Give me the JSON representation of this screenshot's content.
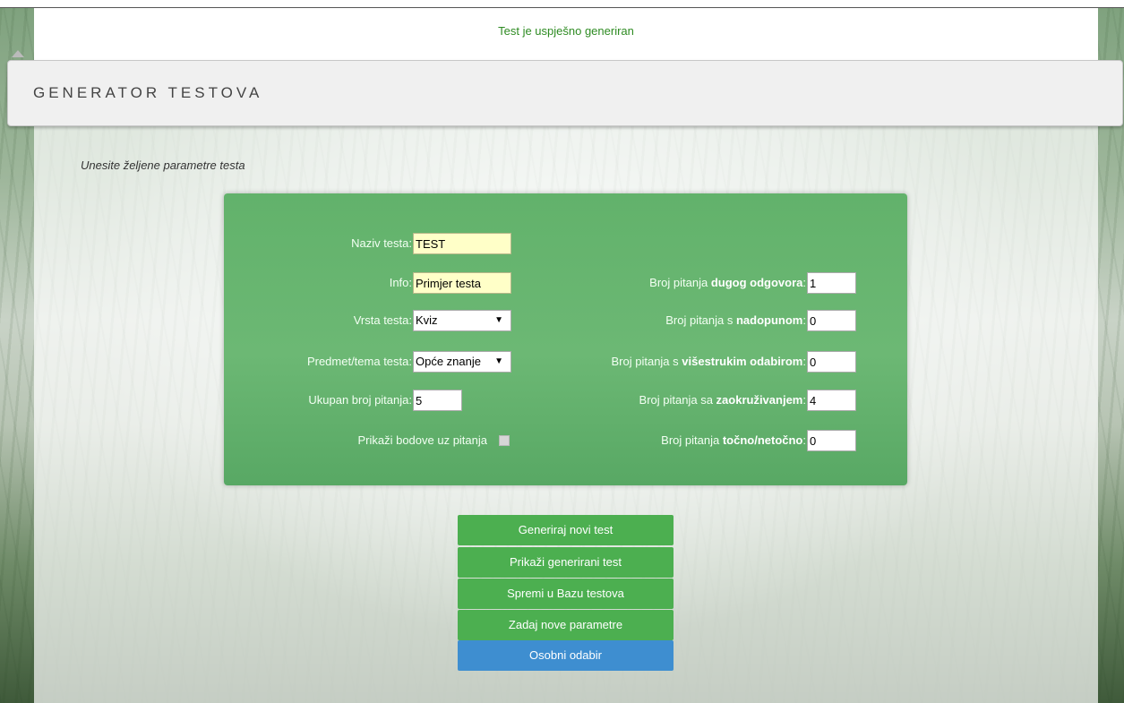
{
  "notice": "Test je uspješno generiran",
  "header": {
    "title": "GENERATOR TESTOVA"
  },
  "instruction": "Unesite željene parametre testa",
  "form": {
    "naziv_label": "Naziv testa:",
    "naziv_value": "TEST",
    "info_label": "Info:",
    "info_value": "Primjer testa",
    "vrsta_label": "Vrsta testa:",
    "vrsta_value": "Kviz",
    "predmet_label": "Predmet/tema testa:",
    "predmet_value": "Opće znanje",
    "ukupan_label": "Ukupan broj pitanja:",
    "ukupan_value": "5",
    "bodovi_label": "Prikaži bodove uz pitanja",
    "dugog": {
      "prefix": "Broj pitanja ",
      "bold": "dugog odgovora",
      "suffix": ":",
      "value": "1"
    },
    "nadopuna": {
      "prefix": "Broj pitanja s ",
      "bold": "nadopunom",
      "suffix": ":",
      "value": "0"
    },
    "visestruki": {
      "prefix": "Broj pitanja s ",
      "bold": "višestrukim odabirom",
      "suffix": ":",
      "value": "0"
    },
    "zaokruzivanje": {
      "prefix": "Broj pitanja sa ",
      "bold": "zaokruživanjem",
      "suffix": ":",
      "value": "4"
    },
    "tocno": {
      "prefix": "Broj pitanja ",
      "bold": "točno/netočno",
      "suffix": ":",
      "value": "0"
    }
  },
  "buttons": {
    "generiraj": "Generiraj novi test",
    "prikazi": "Prikaži generirani test",
    "spremi": "Spremi u Bazu testova",
    "zadaj": "Zadaj nove parametre",
    "osobni": "Osobni odabir"
  },
  "colors": {
    "panel": "#62b26b",
    "button_green": "#4caf50",
    "button_blue": "#3e8ed0",
    "notice_text": "#2e8b22"
  },
  "icons": {
    "dropdown": "triangle-down"
  }
}
